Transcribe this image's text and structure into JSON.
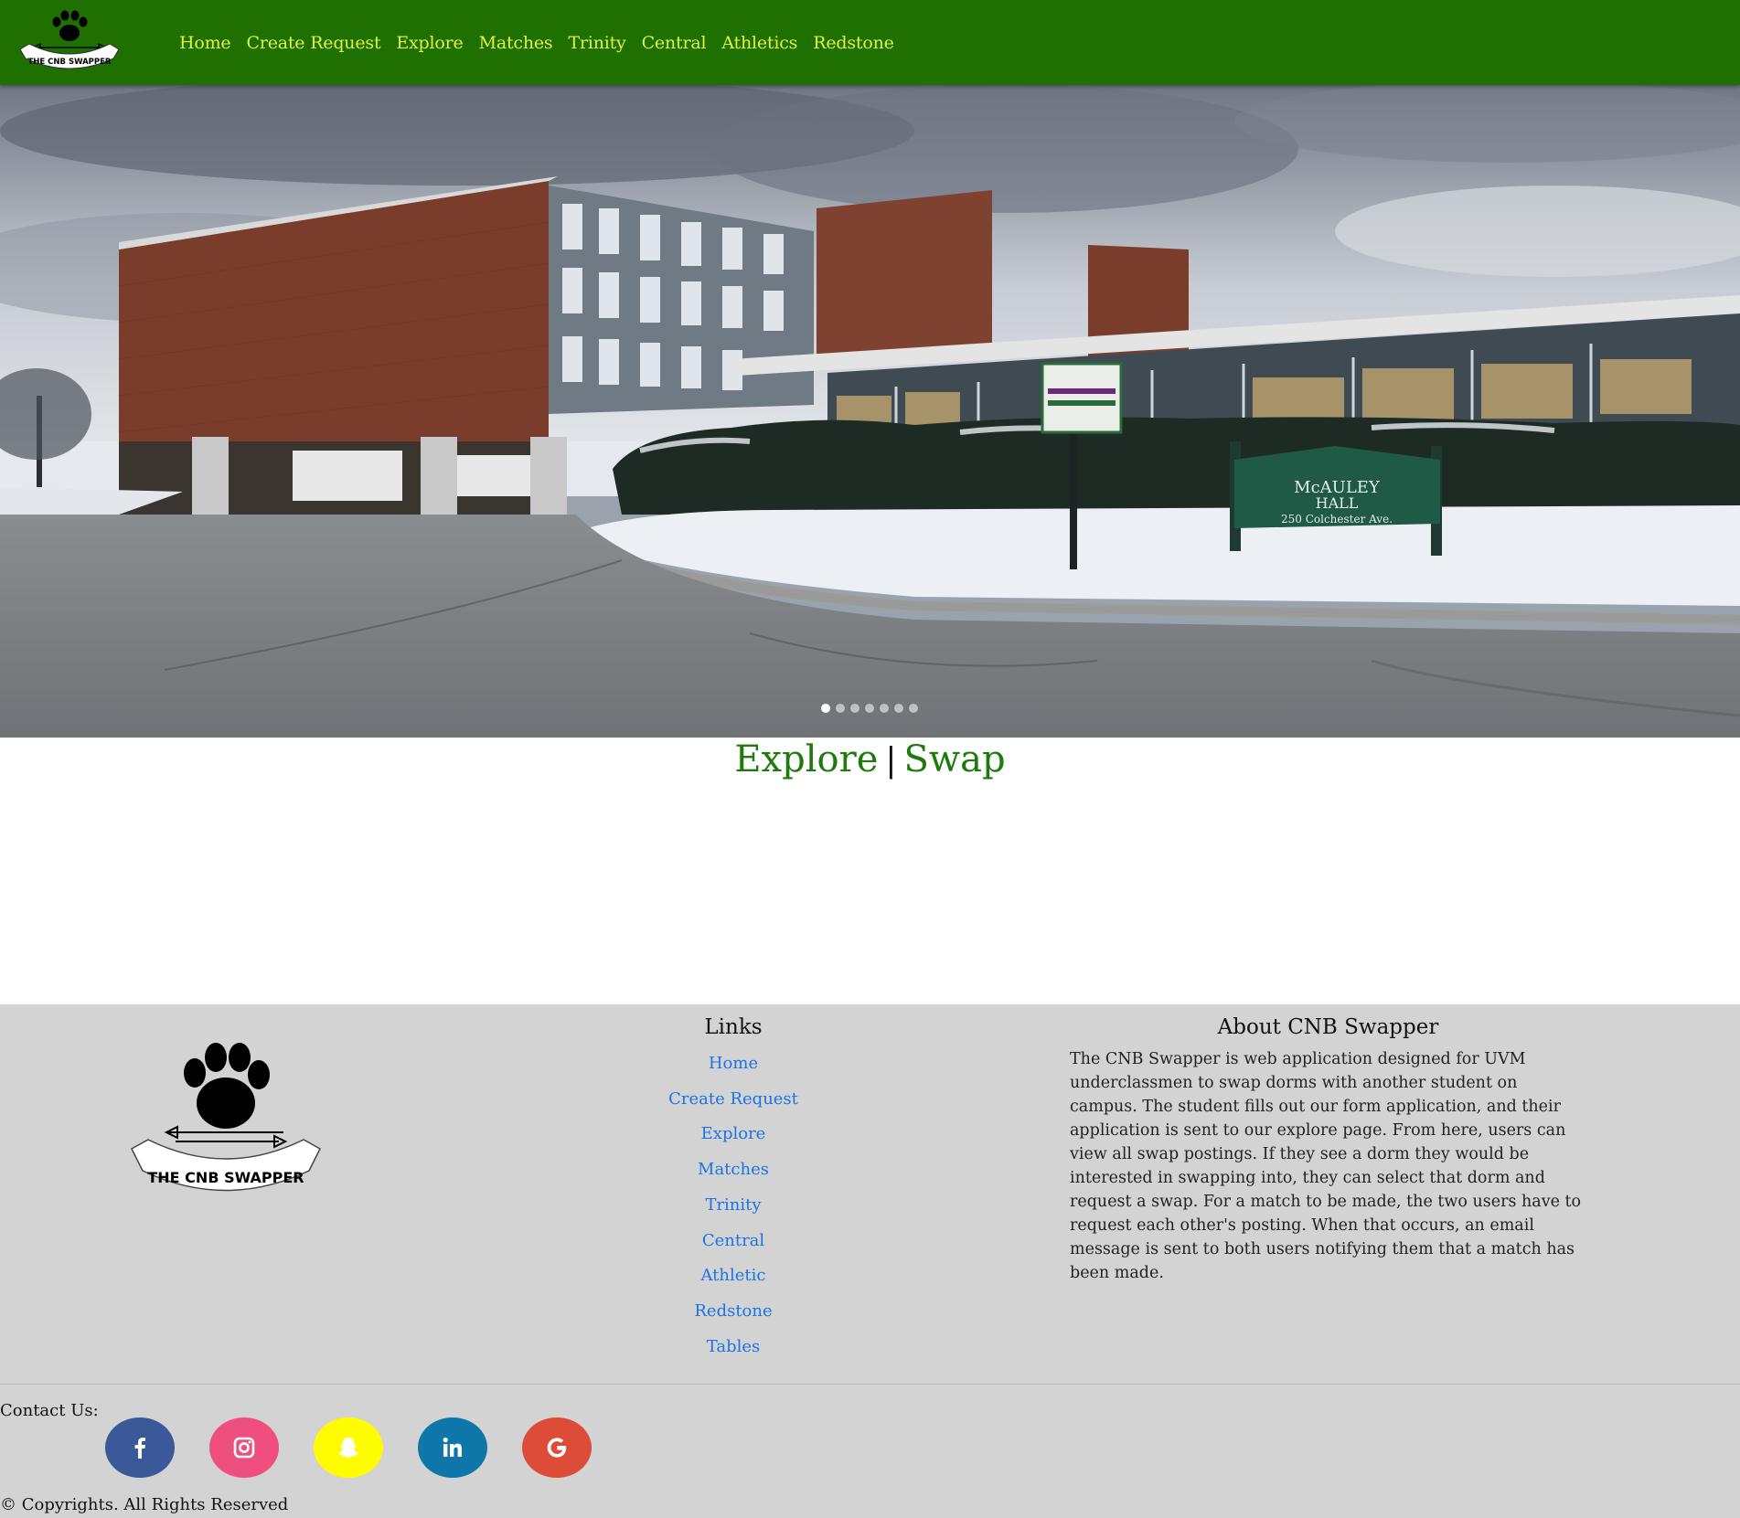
{
  "logo_text": "THE CNB SWAPPER",
  "nav": {
    "items": [
      {
        "label": "Home"
      },
      {
        "label": "Create Request"
      },
      {
        "label": "Explore"
      },
      {
        "label": "Matches"
      },
      {
        "label": "Trinity"
      },
      {
        "label": "Central"
      },
      {
        "label": "Athletics"
      },
      {
        "label": "Redstone"
      }
    ]
  },
  "hero": {
    "sign_line1": "McAULEY",
    "sign_line2": "HALL",
    "sign_line3": "250 Colchester Ave.",
    "slide_count": 7,
    "active_slide": 1
  },
  "headline": {
    "explore": "Explore",
    "separator": "|",
    "swap": "Swap"
  },
  "footer": {
    "links_title": "Links",
    "links": [
      "Home",
      "Create Request",
      "Explore",
      "Matches",
      "Trinity",
      "Central",
      "Athletic",
      "Redstone",
      "Tables"
    ],
    "about_title": "About CNB Swapper",
    "about_text": "The CNB Swapper is web application designed for UVM underclassmen to swap dorms with another student on campus. The student fills out our form application, and their application is sent to our explore page. From here, users can view all swap postings. If they see a dorm they would be interested in swapping into, they can select that dorm and request a swap. For a match to be made, the two users have to request each other's posting. When that occurs, an email message is sent to both users notifying them that a match has been made.",
    "contact_label": "Contact Us:",
    "socials": [
      {
        "name": "facebook-icon",
        "color": "#3b5998"
      },
      {
        "name": "instagram-icon",
        "color": "#ef4f7f"
      },
      {
        "name": "snapchat-icon",
        "color": "#fffc00"
      },
      {
        "name": "linkedin-icon",
        "color": "#0e76a8"
      },
      {
        "name": "google-icon",
        "color": "#dd4b39"
      }
    ],
    "copyright": "© Copyrights. All Rights Reserved"
  },
  "colors": {
    "nav_bg": "#1e7000",
    "nav_link": "#e6f23a",
    "headline": "#1e7a0a",
    "footer_bg": "#d3d3d3",
    "footer_link": "#1a73e8"
  }
}
